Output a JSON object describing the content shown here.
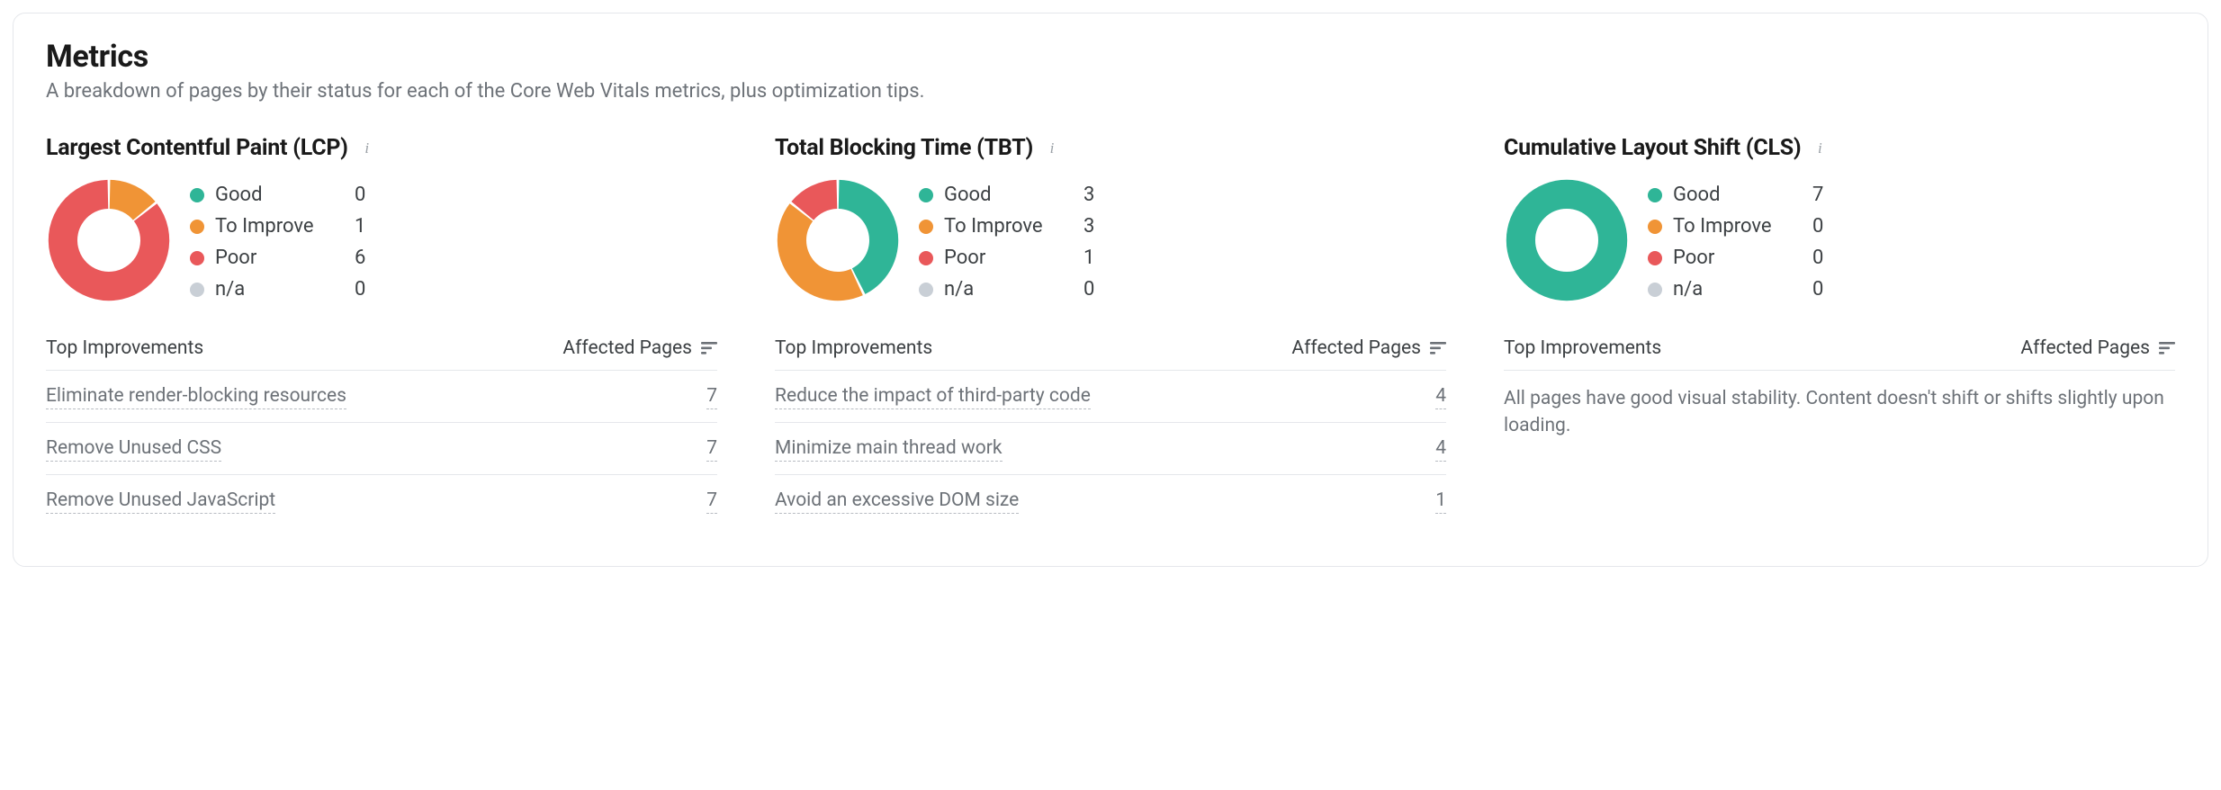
{
  "header": {
    "title": "Metrics",
    "subtitle": "A breakdown of pages by their status for each of the Core Web Vitals metrics, plus optimization tips."
  },
  "legend_labels": {
    "good": "Good",
    "improve": "To Improve",
    "poor": "Poor",
    "na": "n/a"
  },
  "colors": {
    "good": "#2fb597",
    "improve": "#f09436",
    "poor": "#e9585a",
    "na": "#c9cfd6"
  },
  "table_headers": {
    "top_improvements": "Top Improvements",
    "affected_pages": "Affected Pages"
  },
  "cards": [
    {
      "id": "lcp",
      "title": "Largest Contentful Paint (LCP)",
      "values": {
        "good": 0,
        "improve": 1,
        "poor": 6,
        "na": 0
      },
      "improvements": [
        {
          "name": "Eliminate render-blocking resources",
          "pages": 7
        },
        {
          "name": "Remove Unused CSS",
          "pages": 7
        },
        {
          "name": "Remove Unused JavaScript",
          "pages": 7
        }
      ]
    },
    {
      "id": "tbt",
      "title": "Total Blocking Time (TBT)",
      "values": {
        "good": 3,
        "improve": 3,
        "poor": 1,
        "na": 0
      },
      "improvements": [
        {
          "name": "Reduce the impact of third-party code",
          "pages": 4
        },
        {
          "name": "Minimize main thread work",
          "pages": 4
        },
        {
          "name": "Avoid an excessive DOM size",
          "pages": 1
        }
      ]
    },
    {
      "id": "cls",
      "title": "Cumulative Layout Shift (CLS)",
      "values": {
        "good": 7,
        "improve": 0,
        "poor": 0,
        "na": 0
      },
      "improvements": [],
      "empty_message": "All pages have good visual stability. Content doesn't shift or shifts slightly upon loading."
    }
  ],
  "chart_data": [
    {
      "type": "pie",
      "title": "Largest Contentful Paint (LCP)",
      "series": [
        {
          "name": "Good",
          "value": 0,
          "color": "#2fb597"
        },
        {
          "name": "To Improve",
          "value": 1,
          "color": "#f09436"
        },
        {
          "name": "Poor",
          "value": 6,
          "color": "#e9585a"
        },
        {
          "name": "n/a",
          "value": 0,
          "color": "#c9cfd6"
        }
      ]
    },
    {
      "type": "pie",
      "title": "Total Blocking Time (TBT)",
      "series": [
        {
          "name": "Good",
          "value": 3,
          "color": "#2fb597"
        },
        {
          "name": "To Improve",
          "value": 3,
          "color": "#f09436"
        },
        {
          "name": "Poor",
          "value": 1,
          "color": "#e9585a"
        },
        {
          "name": "n/a",
          "value": 0,
          "color": "#c9cfd6"
        }
      ]
    },
    {
      "type": "pie",
      "title": "Cumulative Layout Shift (CLS)",
      "series": [
        {
          "name": "Good",
          "value": 7,
          "color": "#2fb597"
        },
        {
          "name": "To Improve",
          "value": 0,
          "color": "#f09436"
        },
        {
          "name": "Poor",
          "value": 0,
          "color": "#e9585a"
        },
        {
          "name": "n/a",
          "value": 0,
          "color": "#c9cfd6"
        }
      ]
    }
  ]
}
